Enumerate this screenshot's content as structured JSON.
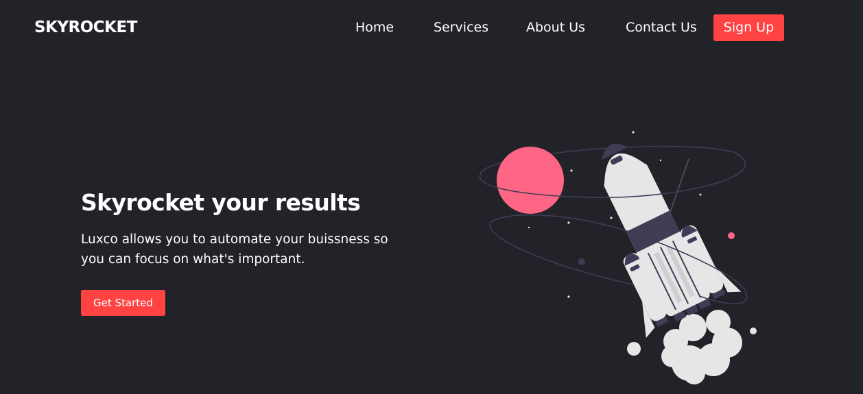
{
  "navbar": {
    "logo": "SKYROCKET",
    "links": [
      "Home",
      "Services",
      "About Us",
      "Contact Us"
    ],
    "signup_label": "Sign Up"
  },
  "hero": {
    "title": "Skyrocket your results",
    "description": "Luxco allows you to automate your buissness so you can focus on what's important.",
    "cta_label": "Get Started"
  },
  "colors": {
    "background": "#222329",
    "accent": "#ff4242",
    "planet": "#ff6584",
    "rocket_body": "#e6e6e6",
    "rocket_dark": "#3f3d56"
  },
  "illustration": {
    "icon": "rocket-launch-illustration"
  }
}
